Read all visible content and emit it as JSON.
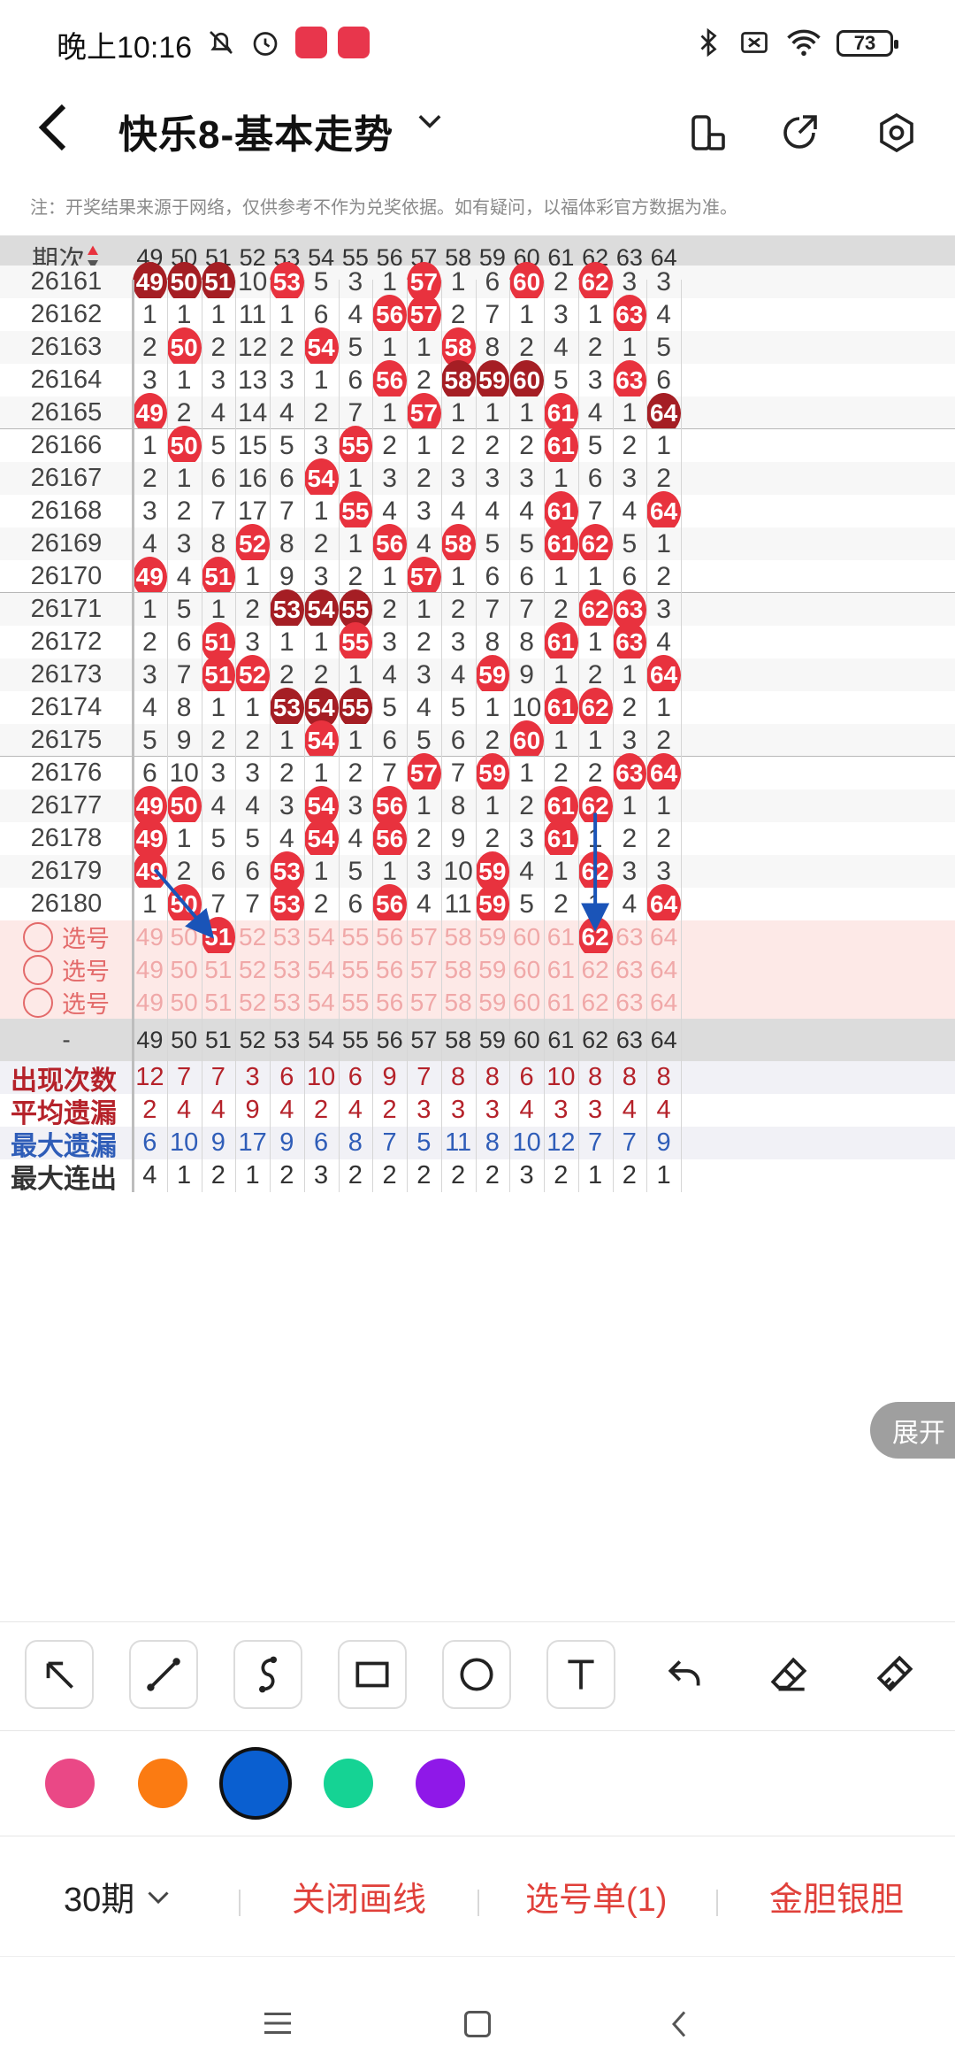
{
  "status": {
    "time": "晚上10:16",
    "battery": "73"
  },
  "header": {
    "title": "快乐8-基本走势"
  },
  "notice": "注：开奖结果来源于网络，仅供参考不作为兑奖依据。如有疑问，以福体彩官方数据为准。",
  "table": {
    "period_label": "期次",
    "columns": [
      "49",
      "50",
      "51",
      "52",
      "53",
      "54",
      "55",
      "56",
      "57",
      "58",
      "59",
      "60",
      "61",
      "62",
      "63",
      "64"
    ],
    "rows": [
      {
        "period": "26161",
        "cells": [
          "49",
          "50",
          "51",
          "10",
          "53",
          "5",
          "3",
          "1",
          "57",
          "1",
          "6",
          "60",
          "2",
          "62",
          "3",
          "3"
        ]
      },
      {
        "period": "26162",
        "cells": [
          "1",
          "1",
          "1",
          "11",
          "1",
          "6",
          "4",
          "56",
          "57",
          "2",
          "7",
          "1",
          "3",
          "1",
          "63",
          "4"
        ]
      },
      {
        "period": "26163",
        "cells": [
          "2",
          "50",
          "2",
          "12",
          "2",
          "54",
          "5",
          "1",
          "1",
          "58",
          "8",
          "2",
          "4",
          "2",
          "1",
          "5"
        ]
      },
      {
        "period": "26164",
        "cells": [
          "3",
          "1",
          "3",
          "13",
          "3",
          "1",
          "6",
          "56",
          "2",
          "58",
          "59",
          "60",
          "5",
          "3",
          "63",
          "6"
        ]
      },
      {
        "period": "26165",
        "cells": [
          "49",
          "2",
          "4",
          "14",
          "4",
          "2",
          "7",
          "1",
          "57",
          "1",
          "1",
          "1",
          "61",
          "4",
          "1",
          "64"
        ]
      },
      {
        "period": "26166",
        "cells": [
          "1",
          "50",
          "5",
          "15",
          "5",
          "3",
          "55",
          "2",
          "1",
          "2",
          "2",
          "2",
          "61",
          "5",
          "2",
          "1"
        ]
      },
      {
        "period": "26167",
        "cells": [
          "2",
          "1",
          "6",
          "16",
          "6",
          "54",
          "1",
          "3",
          "2",
          "3",
          "3",
          "3",
          "1",
          "6",
          "3",
          "2"
        ]
      },
      {
        "period": "26168",
        "cells": [
          "3",
          "2",
          "7",
          "17",
          "7",
          "1",
          "55",
          "4",
          "3",
          "4",
          "4",
          "4",
          "61",
          "7",
          "4",
          "64"
        ]
      },
      {
        "period": "26169",
        "cells": [
          "4",
          "3",
          "8",
          "52",
          "8",
          "2",
          "1",
          "56",
          "4",
          "58",
          "5",
          "5",
          "61",
          "62",
          "5",
          "1"
        ]
      },
      {
        "period": "26170",
        "cells": [
          "49",
          "4",
          "51",
          "1",
          "9",
          "3",
          "2",
          "1",
          "57",
          "1",
          "6",
          "6",
          "1",
          "1",
          "6",
          "2"
        ]
      },
      {
        "period": "26171",
        "cells": [
          "1",
          "5",
          "1",
          "2",
          "53",
          "54",
          "55",
          "2",
          "1",
          "2",
          "7",
          "7",
          "2",
          "62",
          "63",
          "3"
        ]
      },
      {
        "period": "26172",
        "cells": [
          "2",
          "6",
          "51",
          "3",
          "1",
          "1",
          "55",
          "3",
          "2",
          "3",
          "8",
          "8",
          "61",
          "1",
          "63",
          "4"
        ]
      },
      {
        "period": "26173",
        "cells": [
          "3",
          "7",
          "51",
          "52",
          "2",
          "2",
          "1",
          "4",
          "3",
          "4",
          "59",
          "9",
          "1",
          "2",
          "1",
          "64"
        ]
      },
      {
        "period": "26174",
        "cells": [
          "4",
          "8",
          "1",
          "1",
          "53",
          "54",
          "55",
          "5",
          "4",
          "5",
          "1",
          "10",
          "61",
          "62",
          "2",
          "1"
        ]
      },
      {
        "period": "26175",
        "cells": [
          "5",
          "9",
          "2",
          "2",
          "1",
          "54",
          "1",
          "6",
          "5",
          "6",
          "2",
          "60",
          "1",
          "1",
          "3",
          "2"
        ]
      },
      {
        "period": "26176",
        "cells": [
          "6",
          "10",
          "3",
          "3",
          "2",
          "1",
          "2",
          "7",
          "57",
          "7",
          "59",
          "1",
          "2",
          "2",
          "63",
          "64"
        ]
      },
      {
        "period": "26177",
        "cells": [
          "49",
          "50",
          "4",
          "4",
          "3",
          "54",
          "3",
          "56",
          "1",
          "8",
          "1",
          "2",
          "61",
          "62",
          "1",
          "1"
        ]
      },
      {
        "period": "26178",
        "cells": [
          "49",
          "1",
          "5",
          "5",
          "4",
          "54",
          "4",
          "56",
          "2",
          "9",
          "2",
          "3",
          "61",
          "1",
          "2",
          "2"
        ]
      },
      {
        "period": "26179",
        "cells": [
          "49",
          "2",
          "6",
          "6",
          "53",
          "1",
          "5",
          "1",
          "3",
          "10",
          "59",
          "4",
          "1",
          "62",
          "3",
          "3"
        ]
      },
      {
        "period": "26180",
        "cells": [
          "1",
          "50",
          "7",
          "7",
          "53",
          "2",
          "6",
          "56",
          "4",
          "11",
          "59",
          "5",
          "2",
          "1",
          "4",
          "64"
        ]
      }
    ],
    "pick_label": "选号",
    "divider_label": "-",
    "stats": [
      {
        "label": "出现次数",
        "color": "#b5222a",
        "values": [
          "12",
          "7",
          "7",
          "3",
          "6",
          "10",
          "6",
          "9",
          "7",
          "8",
          "8",
          "6",
          "10",
          "8",
          "8",
          "8"
        ]
      },
      {
        "label": "平均遗漏",
        "color": "#b5222a",
        "values": [
          "2",
          "4",
          "4",
          "9",
          "4",
          "2",
          "4",
          "2",
          "3",
          "3",
          "3",
          "4",
          "3",
          "3",
          "4",
          "4"
        ]
      },
      {
        "label": "最大遗漏",
        "color": "#2f5db8",
        "values": [
          "6",
          "10",
          "9",
          "17",
          "9",
          "6",
          "8",
          "7",
          "5",
          "11",
          "8",
          "10",
          "12",
          "7",
          "7",
          "9"
        ]
      },
      {
        "label": "最大连出",
        "color": "#333333",
        "values": [
          "4",
          "1",
          "2",
          "1",
          "2",
          "3",
          "2",
          "2",
          "2",
          "2",
          "2",
          "3",
          "2",
          "1",
          "2",
          "1"
        ]
      }
    ]
  },
  "expand_label": "展开",
  "swatches": [
    "#ea4886",
    "#fb7b12",
    "#0a5fd0",
    "#15d394",
    "#8f18e8"
  ],
  "bottom": {
    "period_select": "30期",
    "close_draw": "关闭画线",
    "pick_list": "选号单(1)",
    "gold_silver": "金胆银胆"
  }
}
